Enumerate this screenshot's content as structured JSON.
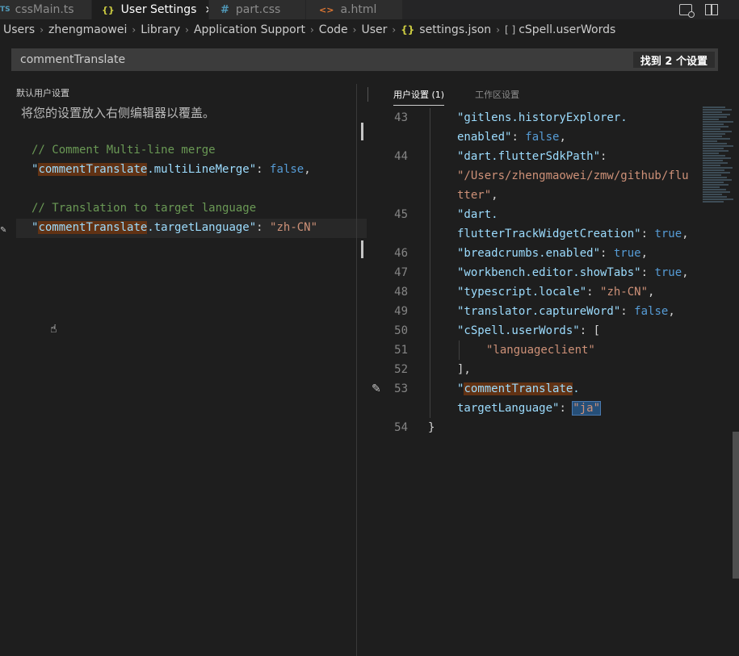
{
  "tabs": [
    {
      "icon": "TS",
      "label": "cssMain.ts"
    },
    {
      "icon": "{}",
      "label": "User Settings",
      "close": "×"
    },
    {
      "icon": "#",
      "label": "part.css"
    },
    {
      "icon": "<>",
      "label": "a.html"
    }
  ],
  "breadcrumb": [
    "Users",
    "zhengmaowei",
    "Library",
    "Application Support",
    "Code",
    "User",
    "settings.json",
    "cSpell.userWords"
  ],
  "breadcrumb_icons": {
    "file": "{}",
    "array": "[ ]"
  },
  "search": {
    "value": "commentTranslate",
    "result_count": "找到 2 个设置"
  },
  "left": {
    "header": "默认用户设置",
    "hint": "将您的设置放入右侧编辑器以覆盖。",
    "comment1": "// Comment Multi-line merge",
    "comment2": "// Translation to target language",
    "quote": "\"",
    "key_highlight": "commentTranslate",
    "key1_rest": ".multiLineMerge",
    "key2_rest": ".targetLanguage",
    "colon": ": ",
    "val1": "false",
    "comma": ",",
    "val2": "\"zh-CN\""
  },
  "right": {
    "tab_user": "用户设置 (1)",
    "tab_workspace": "工作区设置",
    "line_numbers": [
      "43",
      "44",
      "45",
      "46",
      "47",
      "48",
      "49",
      "50",
      "51",
      "52",
      "53",
      "54"
    ],
    "l43a": "\"gitlens.historyExplorer.",
    "l43b": "enabled\"",
    "l44a": "\"dart.flutterSdkPath\"",
    "l44b": "\"/Users/zhengmaowei/zmw/github/flu",
    "l44c": "tter\"",
    "l45a": "\"dart.",
    "l45b": "flutterTrackWidgetCreation\"",
    "l46": "\"breadcrumbs.enabled\"",
    "l47": "\"workbench.editor.showTabs\"",
    "l48k": "\"typescript.locale\"",
    "l48v": "\"zh-CN\"",
    "l49": "\"translator.captureWord\"",
    "l50": "\"cSpell.userWords\"",
    "l50b": ": [",
    "l51": "\"languageclient\"",
    "l52": "],",
    "l53q": "\"",
    "l53k": "commentTranslate",
    "l53dot": ".",
    "l53b": "targetLanguage\"",
    "l53v": "\"ja\"",
    "l54": "}",
    "false": "false",
    "true": "true",
    "colon": ": ",
    "comma": ","
  },
  "colors": {
    "accent": "#007acc",
    "highlight": "#613214",
    "selection": "#264f78"
  }
}
